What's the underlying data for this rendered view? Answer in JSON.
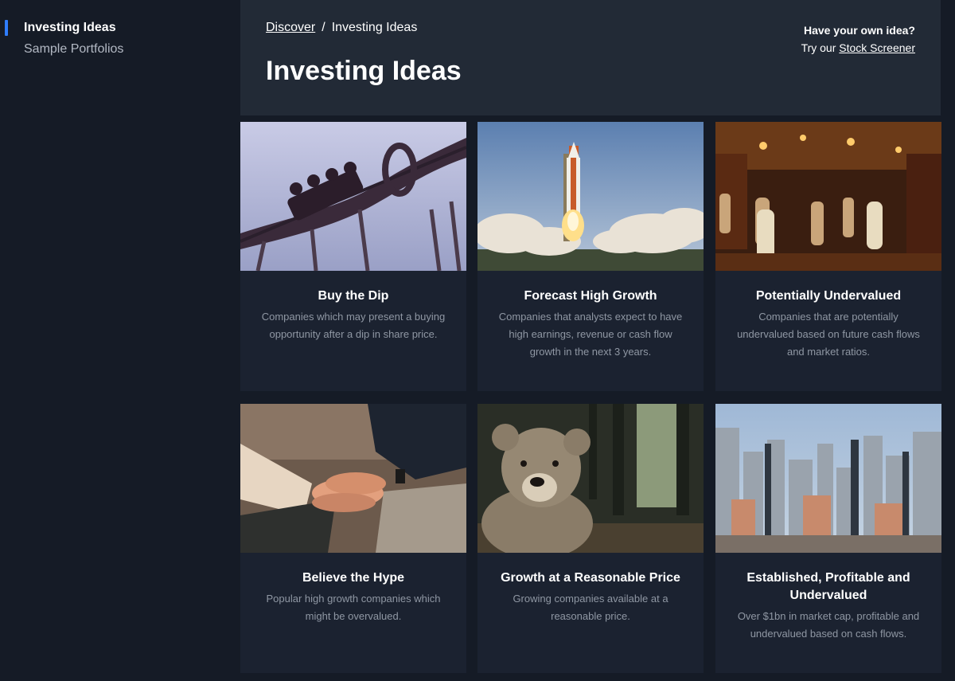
{
  "sidebar": {
    "items": [
      {
        "label": "Investing Ideas",
        "active": true
      },
      {
        "label": "Sample Portfolios",
        "active": false
      }
    ]
  },
  "header": {
    "breadcrumb": {
      "link": "Discover",
      "separator": "/",
      "current": "Investing Ideas"
    },
    "title": "Investing Ideas",
    "promo": {
      "question": "Have your own idea?",
      "prefix": "Try our",
      "link": "Stock Screener"
    }
  },
  "cards": [
    {
      "title": "Buy the Dip",
      "description": "Companies which may present a buying opportunity after a dip in share price.",
      "image": "roller-coaster-image"
    },
    {
      "title": "Forecast High Growth",
      "description": "Companies that analysts expect to have high earnings, revenue or cash flow growth in the next 3 years.",
      "image": "rocket-launch-image"
    },
    {
      "title": "Potentially Undervalued",
      "description": "Companies that are potentially undervalued based on future cash flows and market ratios.",
      "image": "market-bazaar-image"
    },
    {
      "title": "Believe the Hype",
      "description": "Popular high growth companies which might be overvalued.",
      "image": "stacked-hands-image"
    },
    {
      "title": "Growth at a Reasonable Price",
      "description": "Growing companies available at a reasonable price.",
      "image": "teddy-bear-image"
    },
    {
      "title": "Established, Profitable and Undervalued",
      "description": "Over $1bn in market cap, profitable and undervalued based on cash flows.",
      "image": "city-skyline-image"
    }
  ],
  "colors": {
    "background": "#151b26",
    "header_bg": "#222a36",
    "card_bg": "#1b2230",
    "accent": "#2f7dff",
    "muted_text": "#8f97a3"
  }
}
